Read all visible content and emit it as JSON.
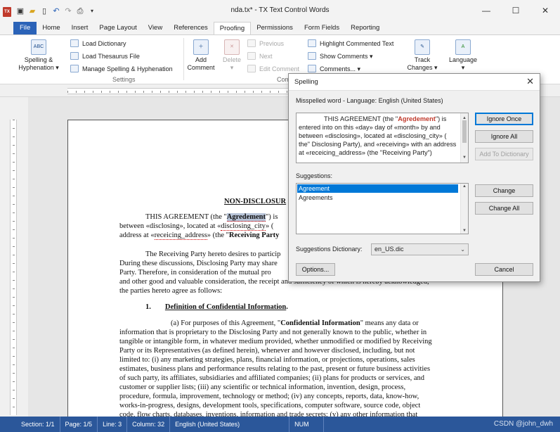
{
  "window": {
    "title": "nda.tx* - TX Text Control Words",
    "app_icon": "TX",
    "quick_access": [
      "save-icon",
      "open-folder-icon",
      "new-document-icon",
      "undo-icon",
      "redo-icon",
      "print-icon",
      "customize-icon"
    ],
    "controls": {
      "minimize": "—",
      "maximize": "☐",
      "close": "✕"
    }
  },
  "tabs": [
    {
      "label": "File"
    },
    {
      "label": "Home"
    },
    {
      "label": "Insert"
    },
    {
      "label": "Page Layout"
    },
    {
      "label": "View"
    },
    {
      "label": "References"
    },
    {
      "label": "Proofing"
    },
    {
      "label": "Permissions"
    },
    {
      "label": "Form Fields"
    },
    {
      "label": "Reporting"
    }
  ],
  "active_tab": "Proofing",
  "ribbon": {
    "settings": {
      "label": "Settings",
      "spelling": {
        "label1": "Spelling &",
        "label2": "Hyphenation ▾",
        "icon_text": "ABC"
      },
      "load_dictionary": "Load Dictionary",
      "load_thesaurus": "Load Thesaurus File",
      "manage": "Manage Spelling & Hyphenation"
    },
    "comments": {
      "label": "Com",
      "add_comment": {
        "label1": "Add",
        "label2": "Comment"
      },
      "delete": {
        "label1": "Delete",
        "label2": "▾"
      },
      "previous": "Previous",
      "next": "Next",
      "edit_comment": "Edit Comment",
      "highlight": "Highlight Commented Text",
      "show_comments": "Show Comments ▾",
      "comments_menu": "Comments... ▾"
    },
    "track_changes": {
      "label1": "Track",
      "label2": "Changes ▾"
    },
    "language": {
      "label1": "Language",
      "label2": "▾"
    }
  },
  "document": {
    "title": "NON-DISCLOSUR",
    "para1": {
      "line1_pre": "THIS AGREEMENT (the \"",
      "line1_word": "Agredement",
      "line1_post": "\") is",
      "line2_pre": "between «disclosing», located at «",
      "line2_field": "disclosing_city",
      "line2_post": "» (",
      "line3_pre": "address at «",
      "line3_field": "receicing_address",
      "line3_post": "» (the \"",
      "line3_bold": "Receiving Party"
    },
    "para2": [
      "The Receiving Party hereto desires to particip",
      "During these discussions, Disclosing Party may share",
      "Party.   Therefore, in consideration of the mutual pro",
      "and other good and valuable consideration, the receipt and sufficiency of which is hereby acknowledged,",
      "the parties hereto agree as follows:"
    ],
    "section1": {
      "number": "1.",
      "heading": "Definition of Confidential Information",
      "period": "."
    },
    "para3": {
      "lead_pre": "(a)        For purposes of this Agreement, \"",
      "lead_bold": "Confidential Information",
      "lead_post": "\" means any data or",
      "lines": [
        "information that is proprietary to the Disclosing Party and not generally known to the public, whether in",
        "tangible or intangible form, in whatever medium provided, whether unmodified or modified by Receiving",
        "Party or its Representatives (as defined herein), whenever and however disclosed, including, but not",
        "limited to: (i) any marketing strategies, plans, financial information, or projections, operations, sales",
        "estimates, business plans and performance results relating to the past, present or future business activities",
        "of such party, its affiliates, subsidiaries and affiliated companies; (ii) plans for products or services, and",
        "customer or supplier lists; (iii) any scientific or technical information, invention, design, process,",
        "procedure, formula, improvement, technology or method; (iv) any concepts, reports, data, know-how,",
        "works-in-progress, designs, development tools, specifications, computer software, source code, object",
        "code, flow charts, databases, inventions, information and trade secrets; (v) any other information that"
      ]
    }
  },
  "status_bar": {
    "section": "Section: 1/1",
    "page": "Page: 1/5",
    "line": "Line: 3",
    "column": "Column: 32",
    "language": "English (United States)",
    "num": "NUM",
    "watermark": "CSDN @john_dwh"
  },
  "spelling_dialog": {
    "title": "Spelling",
    "misspelled_label": "Misspelled word  -  Language: English (United States)",
    "context_text": {
      "pre": "THIS AGREEMENT (the \"",
      "word": "Agredement",
      "post": "\") is entered into on this «day» day of «month» by and between «disclosing», located at «disclosing_city» ( the\" Disclosing Party), and «receiving» with an address at «receicing_address» (the \"Receiving Party\")"
    },
    "suggestions_label": "Suggestions:",
    "suggestions": [
      "Agreement",
      "Agreements"
    ],
    "selected_suggestion": 0,
    "dictionary_label": "Suggestions Dictionary:",
    "dictionary_value": "en_US.dic",
    "buttons": {
      "ignore_once": "Ignore Once",
      "ignore_all": "Ignore All",
      "add_to_dictionary": "Add To Dictionary",
      "change": "Change",
      "change_all": "Change All",
      "options": "Options...",
      "cancel": "Cancel"
    }
  }
}
